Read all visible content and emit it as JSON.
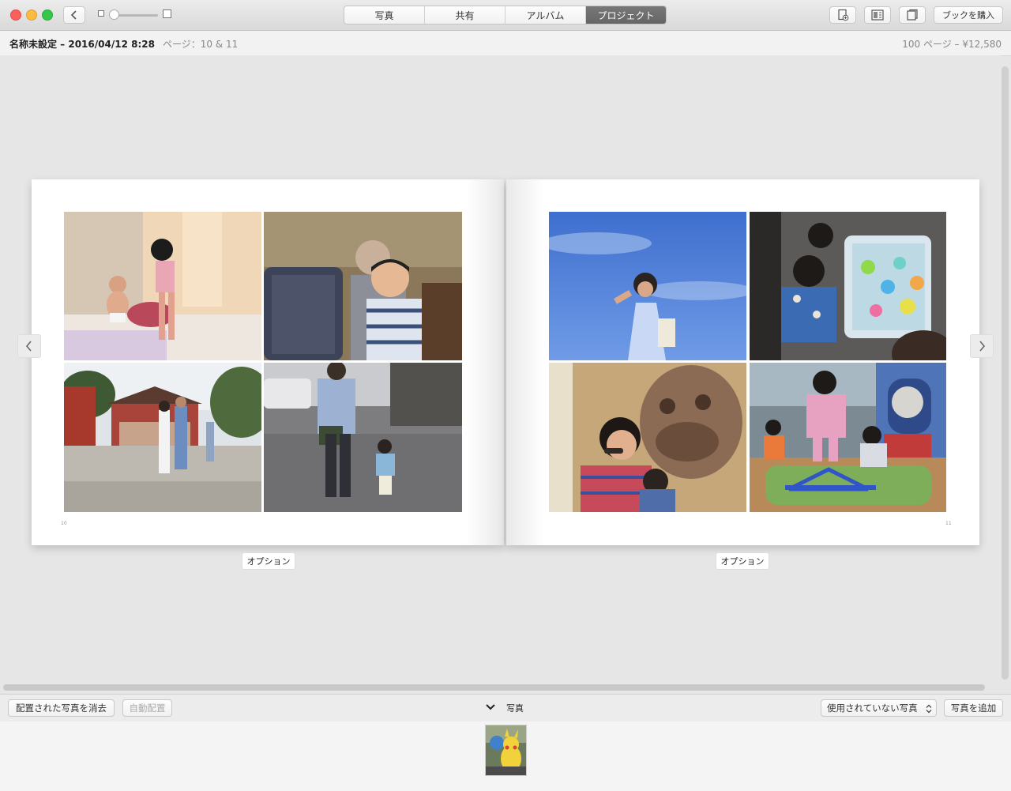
{
  "toolbar": {
    "tabs": [
      {
        "label": "写真",
        "active": false
      },
      {
        "label": "共有",
        "active": false
      },
      {
        "label": "アルバム",
        "active": false
      },
      {
        "label": "プロジェクト",
        "active": true
      }
    ],
    "buy_book_label": "ブックを購入"
  },
  "info": {
    "title": "名称未設定 – 2016/04/12 8:28",
    "pages": "ページ：10 & 11",
    "price": "100 ページ – ¥12,580"
  },
  "spread": {
    "left_page_number": "10",
    "right_page_number": "11",
    "left_option_label": "オプション",
    "right_option_label": "オプション"
  },
  "bottombar": {
    "clear_placed_label": "配置された写真を消去",
    "auto_layout_label": "自動配置",
    "photos_label": "写真",
    "filter_label": "使用されていない写真",
    "add_photos_label": "写真を追加"
  },
  "colors": {
    "active_tab": "#6e6e6e",
    "close": "#fc605c",
    "minimize": "#fdbc40",
    "maximize": "#34c84a"
  }
}
